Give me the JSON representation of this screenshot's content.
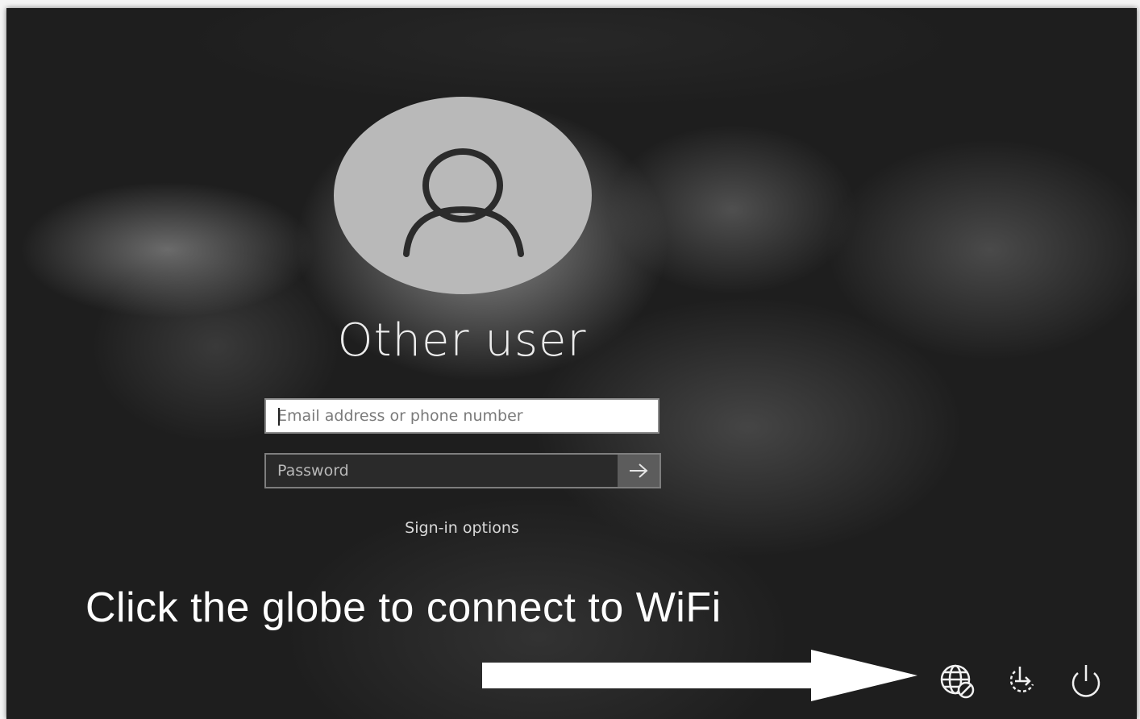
{
  "login": {
    "user_name": "Other user",
    "email_placeholder": "Email address or phone number",
    "email_value": "",
    "password_placeholder": "Password",
    "sign_in_options": "Sign-in options"
  },
  "annotation": {
    "text": "Click the globe to connect to WiFi"
  },
  "tray": {
    "icons": [
      "network-globe-icon",
      "ease-of-access-icon",
      "power-icon"
    ]
  },
  "colors": {
    "background": "#1e1e1e",
    "avatar": "#b9b9b9",
    "text": "#ececec",
    "submit_button": "#5c5c5c"
  }
}
